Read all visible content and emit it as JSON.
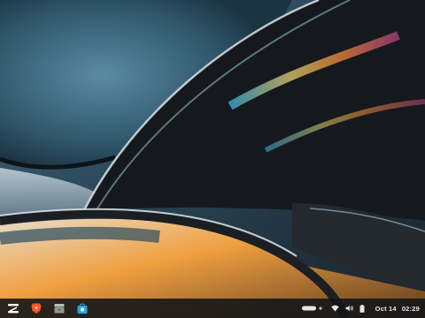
{
  "desktop": {
    "wallpaper_icon": "abstract-glass-curves",
    "colors": {
      "base": "#2f4452",
      "dark": "#14181c",
      "highlight": "#d8e4ec",
      "warm": "#f2a24a"
    }
  },
  "taskbar": {
    "background": "#121418",
    "apps": [
      {
        "name": "zorin-menu",
        "icon": "zorin-logo-icon",
        "color": "#ffffff"
      },
      {
        "name": "brave-browser",
        "icon": "brave-lion-icon",
        "color": "#fb542b"
      },
      {
        "name": "files",
        "icon": "file-cabinet-icon",
        "color": "#9aa6a0"
      },
      {
        "name": "software-store",
        "icon": "store-bag-icon",
        "color": "#2aa4e0"
      }
    ]
  },
  "tray": {
    "icons": [
      "battery-pill-icon",
      "dot-icon",
      "wifi-icon",
      "volume-icon",
      "battery-icon"
    ],
    "clock": {
      "date": "Oct 14",
      "time": "02:29"
    }
  }
}
